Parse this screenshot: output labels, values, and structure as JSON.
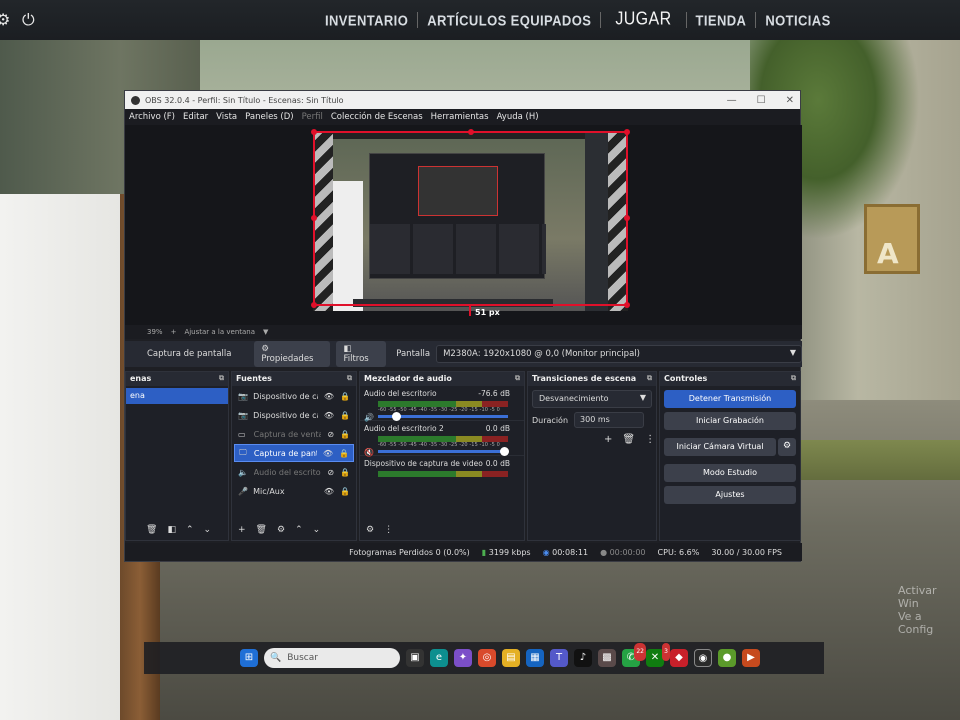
{
  "game_nav": {
    "items": [
      "INVENTARIO",
      "ARTÍCULOS EQUIPADOS",
      "JUGAR",
      "TIENDA",
      "NOTICIAS"
    ]
  },
  "scene_sign": "A",
  "obs": {
    "title": "OBS 32.0.4 - Perfil: Sin Título - Escenas: Sin Título",
    "menu": [
      "Archivo (F)",
      "Editar",
      "Vista",
      "Paneles (D)",
      "Perfil",
      "Colección de Escenas",
      "Herramientas",
      "Ayuda (H)"
    ],
    "preview_offset_label": "51 px",
    "zoom": {
      "percent": "39%",
      "fit_label": "Ajustar a la ventana"
    },
    "source_bar": {
      "source_name": "Captura de pantalla",
      "properties": "Propiedades",
      "filters": "Filtros",
      "display_label": "Pantalla",
      "display_value": "M2380A: 1920x1080 @ 0,0 (Monitor principal)"
    },
    "docks": {
      "scenes": {
        "title": "enas",
        "items": [
          "ena"
        ]
      },
      "sources": {
        "title": "Fuentes",
        "items": [
          {
            "name": "Dispositivo de cap",
            "icon": "camera-icon"
          },
          {
            "name": "Dispositivo de cap",
            "icon": "camera-icon"
          },
          {
            "name": "Captura de ventar",
            "icon": "window-icon"
          },
          {
            "name": "Captura de pantal",
            "icon": "monitor-icon"
          },
          {
            "name": "Audio del escritori",
            "icon": "speaker-icon"
          },
          {
            "name": "Mic/Aux",
            "icon": "mic-icon"
          }
        ]
      },
      "mixer": {
        "title": "Mezclador de audio",
        "channels": [
          {
            "name": "Audio del escritorio",
            "db": "-76.6 dB",
            "level": 0.88
          },
          {
            "name": "Audio del escritorio 2",
            "db": "0.0 dB",
            "level": 1.0
          },
          {
            "name": "Dispositivo de captura de video",
            "db": "0.0 dB",
            "level": 1.0
          }
        ],
        "scale": "-60 -55 -50 -45 -40 -35 -30 -25 -20 -15 -10 -5 0"
      },
      "transitions": {
        "title": "Transiciones de escena",
        "selected": "Desvanecimiento",
        "duration_label": "Duración",
        "duration_value": "300 ms"
      },
      "controls": {
        "title": "Controles",
        "stop_stream": "Detener Transmisión",
        "start_record": "Iniciar Grabación",
        "virtual_cam": "Iniciar Cámara Virtual",
        "studio_mode": "Modo Estudio",
        "settings": "Ajustes"
      }
    },
    "status": {
      "dropped": "Fotogramas Perdidos 0 (0.0%)",
      "bitrate": "3199 kbps",
      "stream_time": "00:08:11",
      "record_time": "00:00:00",
      "cpu": "CPU: 6.6%",
      "fps": "30.00 / 30.00 FPS"
    }
  },
  "taskbar": {
    "search_placeholder": "Buscar",
    "badge1": "22",
    "badge2": "3"
  },
  "watermark": {
    "line1": "Activar Win",
    "line2": "Ve a Config"
  }
}
